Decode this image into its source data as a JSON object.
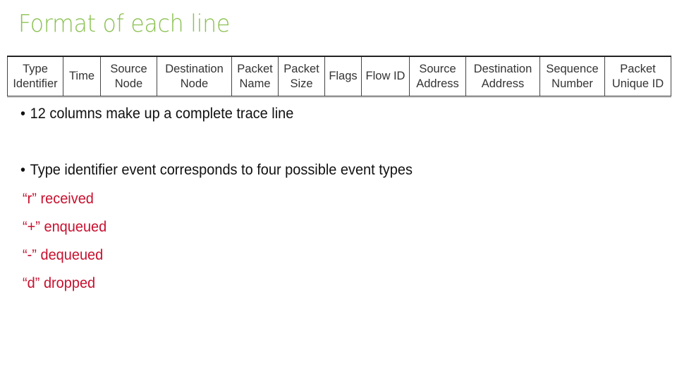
{
  "slide": {
    "title": "Format of each line",
    "title_color": "#8cc152"
  },
  "trace_format": {
    "columns": [
      {
        "line1": "Type",
        "line2": "Identifier"
      },
      {
        "line1": "Time",
        "line2": ""
      },
      {
        "line1": "Source",
        "line2": "Node"
      },
      {
        "line1": "Destination",
        "line2": "Node"
      },
      {
        "line1": "Packet",
        "line2": "Name"
      },
      {
        "line1": "Packet",
        "line2": "Size"
      },
      {
        "line1": "Flags",
        "line2": ""
      },
      {
        "line1": "Flow ID",
        "line2": ""
      },
      {
        "line1": "Source",
        "line2": "Address"
      },
      {
        "line1": "Destination",
        "line2": "Address"
      },
      {
        "line1": "Sequence",
        "line2": "Number"
      },
      {
        "line1": "Packet",
        "line2": "Unique ID"
      }
    ]
  },
  "bullets": [
    {
      "bullet": "•",
      "text": "12 columns make up a complete trace line"
    },
    {
      "bullet": "•",
      "text": "Type identifier event corresponds to four possible event types"
    }
  ],
  "event_types": {
    "color": "#c8102e",
    "items": [
      {
        "code": "“r”",
        "label": "received"
      },
      {
        "code": "“+”",
        "label": "enqueued"
      },
      {
        "code": "“-”",
        "label": "dequeued"
      },
      {
        "code": "“d”",
        "label": "dropped"
      }
    ]
  }
}
